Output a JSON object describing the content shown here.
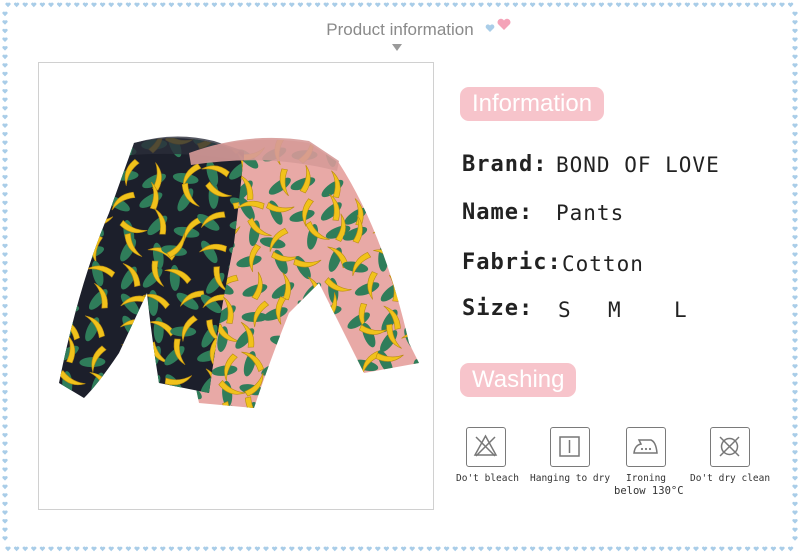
{
  "header": {
    "title": "Product information"
  },
  "information": {
    "heading": "Information",
    "brand": {
      "label": "Brand:",
      "value": "BOND OF LOVE"
    },
    "name": {
      "label": "Name:",
      "value": "Pants"
    },
    "fabric": {
      "label": "Fabric:",
      "value": "Cotton"
    },
    "size": {
      "label": "Size:",
      "options": [
        "S",
        "M",
        "L"
      ]
    }
  },
  "washing": {
    "heading": "Washing",
    "items": [
      {
        "icon": "no-bleach-icon",
        "label": "Do't bleach"
      },
      {
        "icon": "hang-dry-icon",
        "label": "Hanging to dry"
      },
      {
        "icon": "iron-icon",
        "label": "Ironing",
        "label2": "below 130°C"
      },
      {
        "icon": "no-dry-clean-icon",
        "label": "Do't dry clean"
      }
    ]
  },
  "colors": {
    "pill": "#f7c4cb",
    "border_dots": "#a9cde8",
    "heart": "#f4a3b8",
    "fabric_black": "#1c1f2b",
    "fabric_pink": "#e8a9a6",
    "banana": "#f1c21b",
    "leaf": "#2f7d5a"
  }
}
